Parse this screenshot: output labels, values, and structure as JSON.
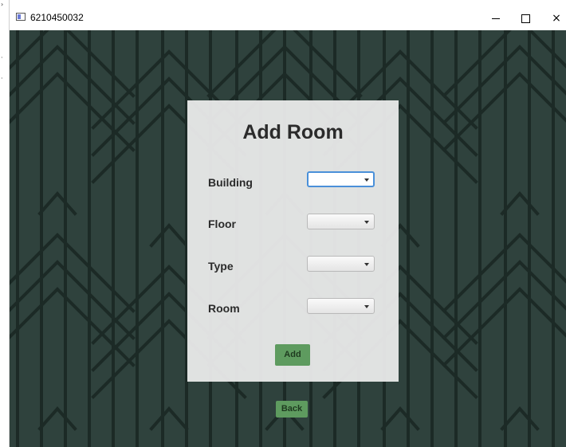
{
  "window": {
    "title": "6210450032",
    "controls": {
      "minimize": "minimize",
      "maximize": "maximize",
      "close": "×"
    }
  },
  "form": {
    "title": "Add Room",
    "fields": [
      {
        "label": "Building",
        "value": "",
        "focused": true
      },
      {
        "label": "Floor",
        "value": ""
      },
      {
        "label": "Type",
        "value": ""
      },
      {
        "label": "Room",
        "value": ""
      }
    ],
    "add_label": "Add"
  },
  "back_label": "Back",
  "colors": {
    "background": "#2f423d",
    "pattern_line": "#1c2a26",
    "button": "#5e9b5f",
    "focus": "#4a90d9"
  },
  "icons": {
    "app": "window-app-icon",
    "minimize": "minimize-icon",
    "maximize": "maximize-icon",
    "close": "close-icon",
    "combo": "chevron-down-icon"
  }
}
